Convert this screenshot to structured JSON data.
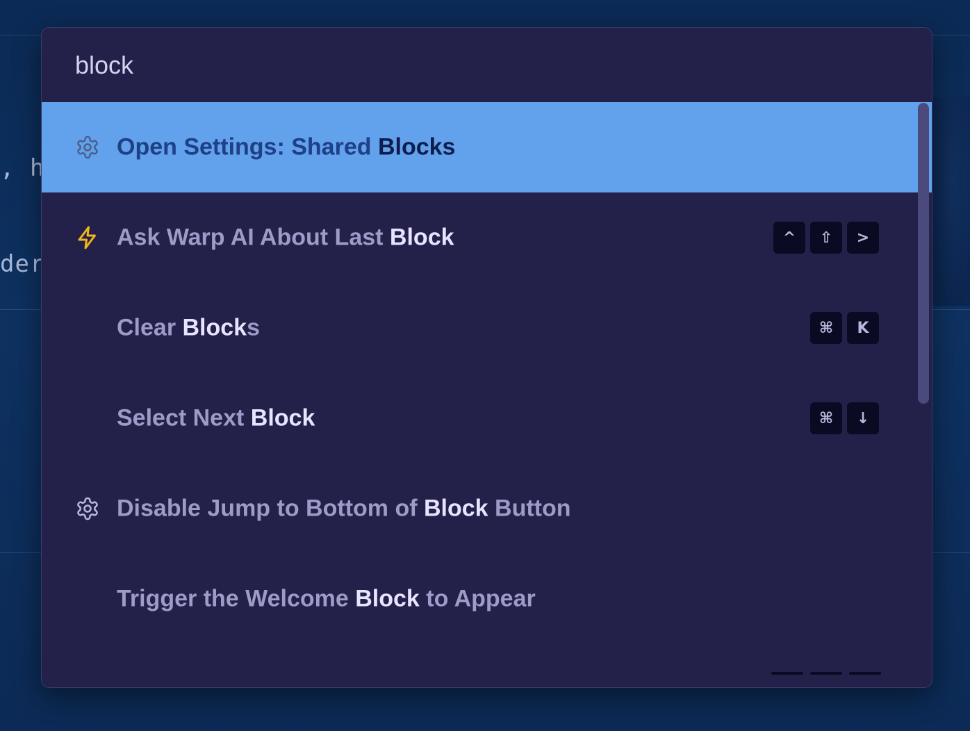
{
  "background": {
    "text_fragment_1": ", h",
    "text_fragment_2": "der"
  },
  "search": {
    "value": "block"
  },
  "commands": [
    {
      "icon": "gear-icon",
      "selected": true,
      "label_segments": [
        {
          "text": "Open Settings: Shared ",
          "highlight": false
        },
        {
          "text": "Block",
          "highlight": true
        },
        {
          "text": "s",
          "highlight": true
        }
      ],
      "keys": []
    },
    {
      "icon": "lightning-icon",
      "selected": false,
      "label_segments": [
        {
          "text": "Ask Warp AI About Last ",
          "highlight": false
        },
        {
          "text": "Block",
          "highlight": true
        }
      ],
      "keys": [
        "^",
        "⇧",
        ">"
      ]
    },
    {
      "icon": "",
      "selected": false,
      "label_segments": [
        {
          "text": "Clear ",
          "highlight": false
        },
        {
          "text": "Block",
          "highlight": true
        },
        {
          "text": "s",
          "highlight": false
        }
      ],
      "keys": [
        "⌘",
        "K"
      ]
    },
    {
      "icon": "",
      "selected": false,
      "label_segments": [
        {
          "text": "Select Next ",
          "highlight": false
        },
        {
          "text": "Block",
          "highlight": true
        }
      ],
      "keys": [
        "⌘",
        "↓"
      ]
    },
    {
      "icon": "gear-icon",
      "selected": false,
      "label_segments": [
        {
          "text": "Disable Jump to Bottom of ",
          "highlight": false
        },
        {
          "text": "Block",
          "highlight": true
        },
        {
          "text": " Button",
          "highlight": false
        }
      ],
      "keys": []
    },
    {
      "icon": "",
      "selected": false,
      "label_segments": [
        {
          "text": "Trigger the Welcome ",
          "highlight": false
        },
        {
          "text": "Block",
          "highlight": true
        },
        {
          "text": " to Appear",
          "highlight": false
        }
      ],
      "keys": []
    }
  ],
  "colors": {
    "selected_bg": "#62a2ec",
    "palette_bg": "#23204a",
    "lightning": "#f2b51c"
  }
}
